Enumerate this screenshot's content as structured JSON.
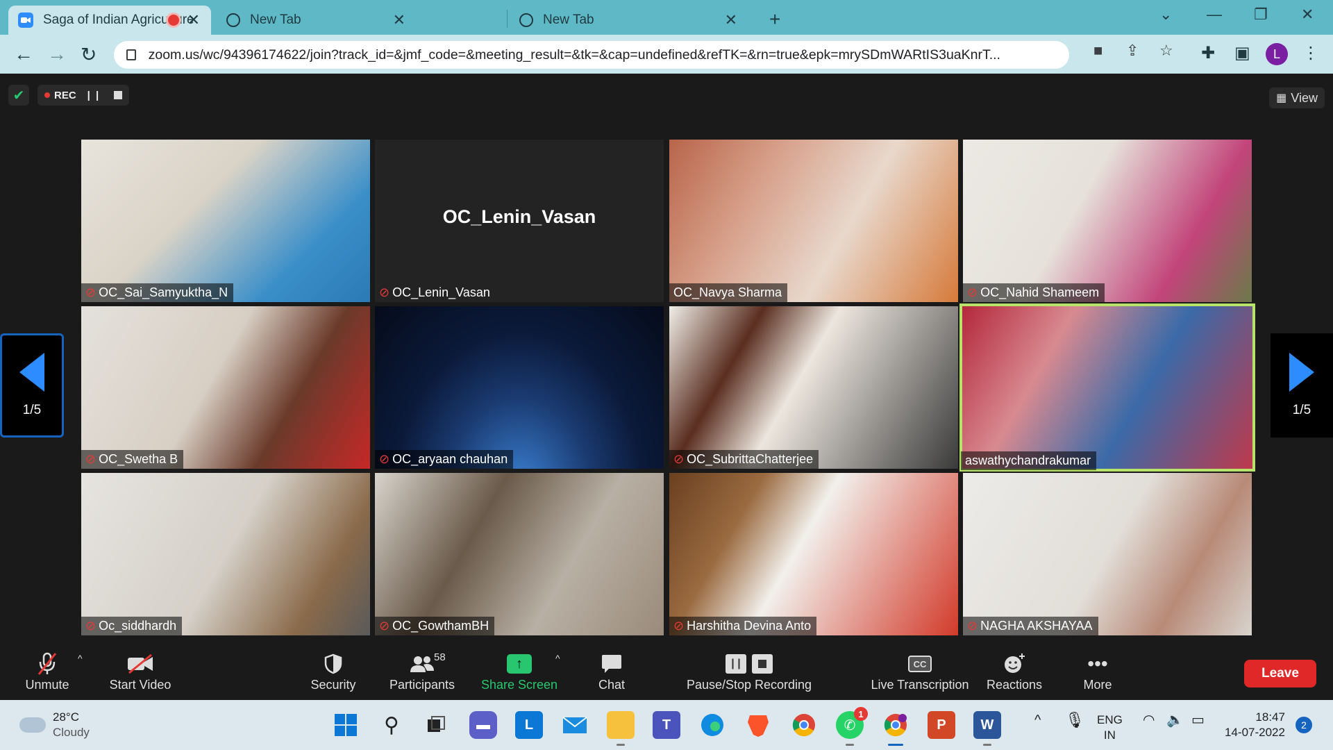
{
  "browser": {
    "tabs": [
      {
        "title": "Saga of Indian Agriculture",
        "active": true
      },
      {
        "title": "New Tab",
        "active": false
      },
      {
        "title": "New Tab",
        "active": false
      }
    ],
    "url": "zoom.us/wc/94396174622/join?track_id=&jmf_code=&meeting_result=&tk=&cap=undefined&refTK=&rn=true&epk=mrySDmWARtIS3uaKnrT...",
    "profile_initial": "L"
  },
  "meeting": {
    "rec_label": "REC",
    "view_label": "View",
    "page_indicator": "1/5",
    "participants_grid": [
      {
        "name": "OC_Sai_Samyuktha_N",
        "muted": true,
        "video": true
      },
      {
        "name": "OC_Lenin_Vasan",
        "muted": true,
        "video": false,
        "center_name": "OC_Lenin_Vasan"
      },
      {
        "name": "OC_Navya Sharma",
        "muted": false,
        "video": true
      },
      {
        "name": "OC_Nahid Shameem",
        "muted": true,
        "video": true
      },
      {
        "name": "OC_Swetha B",
        "muted": true,
        "video": true
      },
      {
        "name": "OC_aryaan chauhan",
        "muted": true,
        "video": true
      },
      {
        "name": "OC_SubrittaChatterjee",
        "muted": true,
        "video": true
      },
      {
        "name": "aswathychandrakumar",
        "muted": false,
        "video": true,
        "speaking": true
      },
      {
        "name": "Oc_siddhardh",
        "muted": true,
        "video": true
      },
      {
        "name": "OC_GowthamBH",
        "muted": true,
        "video": true
      },
      {
        "name": "Harshitha Devina Anto",
        "muted": true,
        "video": true
      },
      {
        "name": "NAGHA AKSHAYAA",
        "muted": true,
        "video": true
      }
    ]
  },
  "footer": {
    "unmute": "Unmute",
    "start_video": "Start Video",
    "security": "Security",
    "participants": "Participants",
    "participants_count": "58",
    "share_screen": "Share Screen",
    "chat": "Chat",
    "recording": "Pause/Stop Recording",
    "transcription": "Live Transcription",
    "cc": "CC",
    "reactions": "Reactions",
    "more": "More",
    "leave": "Leave"
  },
  "taskbar": {
    "temperature": "28°C",
    "weather": "Cloudy",
    "whatsapp_badge": "1",
    "lang_top": "ENG",
    "lang_bottom": "IN",
    "time": "18:47",
    "date": "14-07-2022",
    "notifications": "2"
  },
  "colors": {
    "tabbar": "#5fb8c6",
    "toolbar": "#c8e6ec",
    "zoom_blue": "#2d8cff",
    "leave_red": "#e02828",
    "share_green": "#28c76f",
    "speaking_border": "#b7e36a"
  }
}
